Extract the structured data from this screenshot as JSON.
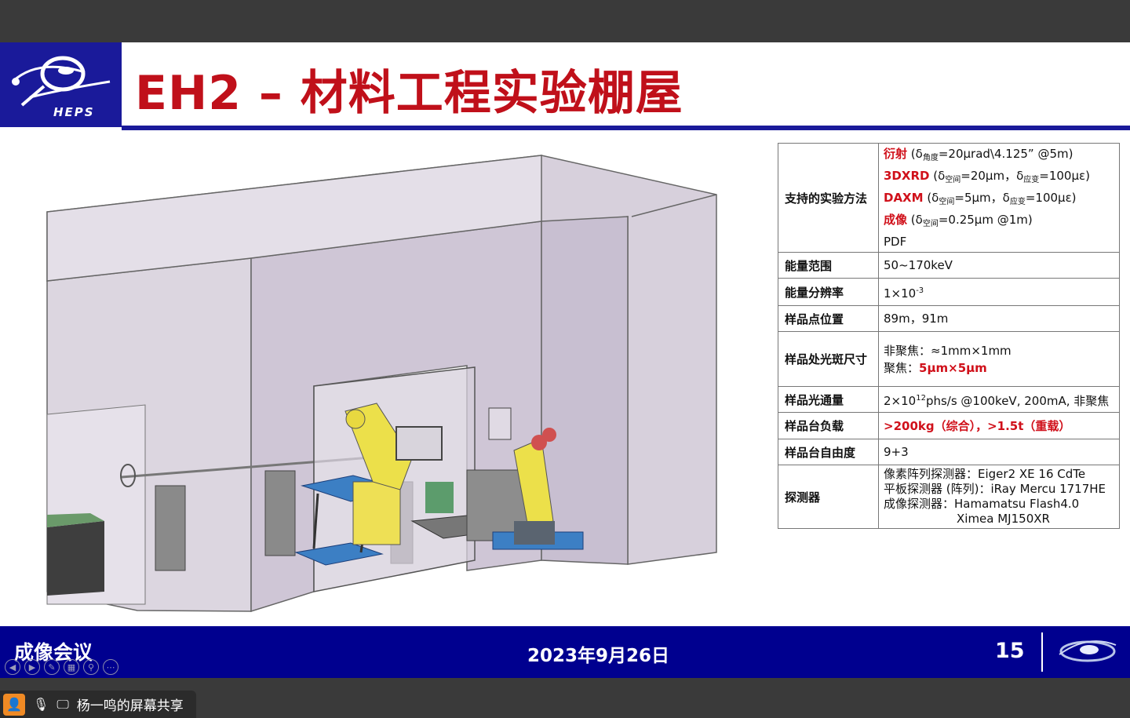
{
  "slide": {
    "logo_text": "HEPS",
    "title": "EH2 – 材料工程实验棚屋",
    "spec_table": {
      "methods_key": "支持的实验方法",
      "methods": [
        {
          "name": "衍射",
          "pre": " (δ",
          "sub1": "角度",
          "rest": "=20μrad\\4.125”  @5m)"
        },
        {
          "name": "3DXRD",
          "pre": " (δ",
          "sub1": "空间",
          "mid": "=20μm，δ",
          "sub2": "应变",
          "rest": "=100με)"
        },
        {
          "name": "DAXM",
          "pre": " (δ",
          "sub1": "空间",
          "mid": "=5μm，δ",
          "sub2": "应变",
          "rest": "=100με)"
        },
        {
          "name": "成像",
          "pre": " (δ",
          "sub1": "空间",
          "rest": "=0.25μm @1m)"
        }
      ],
      "methods_pdf": "PDF",
      "energy_range_key": "能量范围",
      "energy_range": "50~170keV",
      "energy_res_key": "能量分辨率",
      "energy_res_base": "1×10",
      "energy_res_exp": "-3",
      "sample_pos_key": "样品点位置",
      "sample_pos": "89m，91m",
      "spot_key": "样品处光斑尺寸",
      "spot_unfocused": "非聚焦：≈1mm×1mm",
      "spot_focused_label": "聚焦：",
      "spot_focused_value": "5μm×5μm",
      "flux_key": "样品光通量",
      "flux_base": "2×10",
      "flux_exp": "12",
      "flux_rest": "phs/s @100keV, 200mA, 非聚焦",
      "load_key": "样品台负载",
      "load": ">200kg（综合），>1.5t（重载）",
      "dof_key": "样品台自由度",
      "dof": "9+3",
      "detector_key": "探测器",
      "detectors": [
        "像素阵列探测器：Eiger2 XE 16 CdTe",
        "平板探测器 (阵列)：iRay Mercu 1717HE",
        "成像探测器：Hamamatsu  Flash4.0",
        "Ximea MJ150XR"
      ]
    },
    "footer": {
      "left": "成像会议",
      "date": "2023年9月26日",
      "page": "15"
    }
  },
  "share_bar": {
    "text": "杨一鸣的屏幕共享"
  },
  "colors": {
    "navy": "#1a1a9a",
    "title_red": "#c0101a",
    "footer_blue": "#00008f"
  }
}
